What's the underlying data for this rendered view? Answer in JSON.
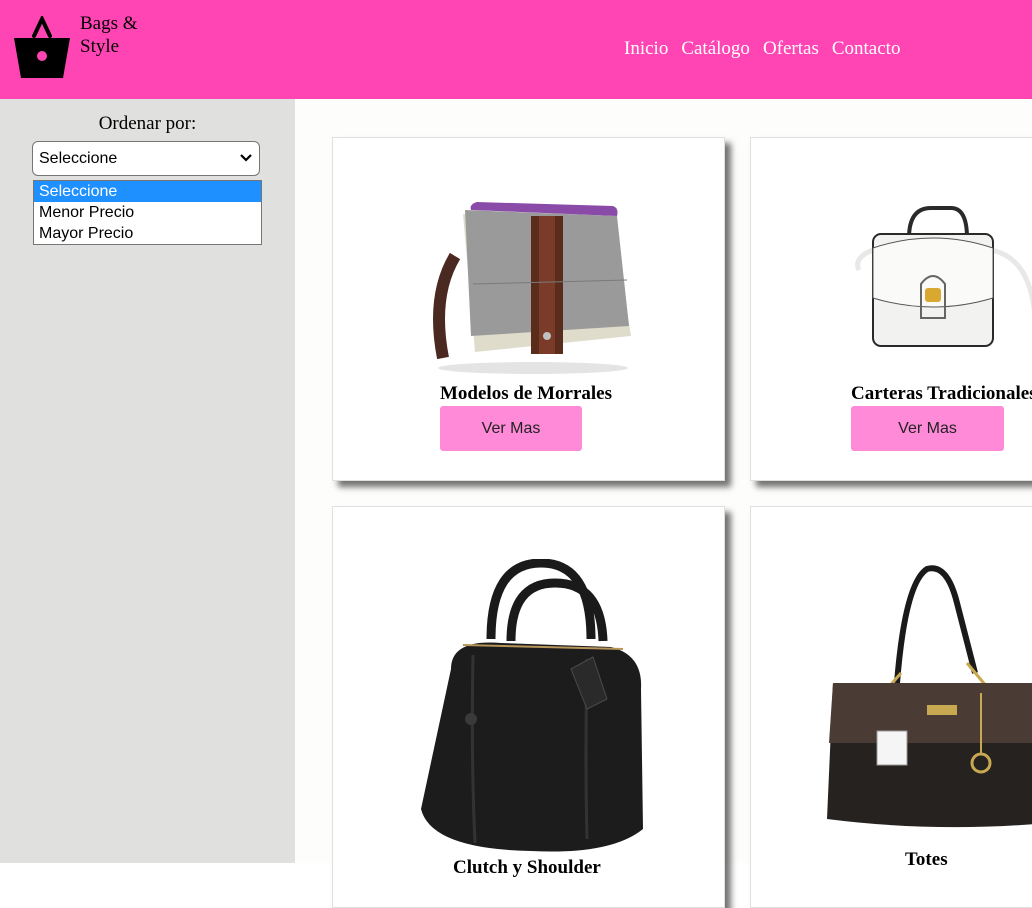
{
  "brand": {
    "line1": "Bags &",
    "line2": "Style",
    "logo_icon": "shopping-basket-icon"
  },
  "nav": {
    "items": [
      "Inicio",
      "Catálogo",
      "Ofertas",
      "Contacto"
    ]
  },
  "sidebar": {
    "sort_label": "Ordenar por:",
    "select": {
      "value": "Seleccione",
      "options": [
        "Seleccione",
        "Menor Precio",
        "Mayor Precio"
      ],
      "highlighted": 0
    }
  },
  "products": [
    {
      "title": "Modelos de Morrales",
      "button": "Ver Mas",
      "image": "messenger-bag-image"
    },
    {
      "title": "Carteras Tradicionales",
      "button": "Ver Mas",
      "image": "white-handbag-image"
    },
    {
      "title": "Clutch y Shoulder",
      "button": "",
      "image": "black-bowling-bag-image"
    },
    {
      "title": "Totes",
      "button": "",
      "image": "black-tote-bag-image"
    }
  ],
  "colors": {
    "header": "#ff44b4",
    "button": "#ff8ad8",
    "sidebar": "#e0e0de",
    "selected_option": "#1e90ff"
  }
}
